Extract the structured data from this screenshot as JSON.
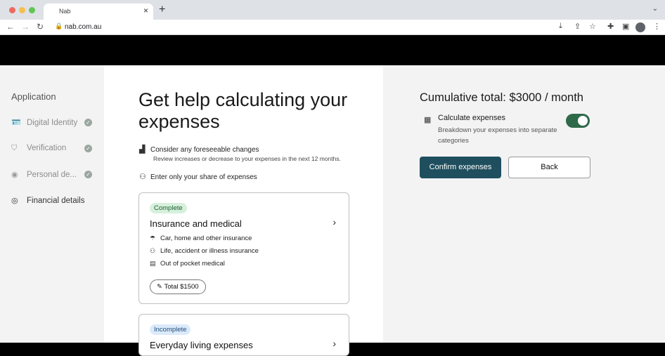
{
  "browser": {
    "tab_title": "Nab",
    "tab_close": "×",
    "new_tab": "+",
    "menu_chevron": "⌄",
    "url": "nab.com.au",
    "traffic_colors": [
      "#ed6a5e",
      "#f5bf4f",
      "#61c554"
    ]
  },
  "sidebar": {
    "title": "Application",
    "items": [
      {
        "label": "Digital Identity",
        "icon": "id-card-icon",
        "done": true
      },
      {
        "label": "Verification",
        "icon": "shield-check-icon",
        "done": true
      },
      {
        "label": "Personal de...",
        "icon": "person-icon",
        "done": true
      },
      {
        "label": "Financial details",
        "icon": "coins-icon",
        "done": false
      }
    ],
    "check_glyph": "✓"
  },
  "main": {
    "heading": "Get help calculating your expenses",
    "tips": [
      {
        "title": "Consider any foreseeable changes",
        "sub": "Review increases or decrease to your expenses in the next 12 months.",
        "icon": "chart-icon"
      },
      {
        "title": "Enter only your share of expenses",
        "icon": "people-icon"
      }
    ],
    "cards": [
      {
        "badge": "Complete",
        "title": "Insurance and medical",
        "lines": [
          {
            "text": "Car, home and other insurance",
            "icon": "umbrella-icon"
          },
          {
            "text": "Life, accident or illness insurance",
            "icon": "people-icon"
          },
          {
            "text": "Out of pocket medical",
            "icon": "medical-icon"
          }
        ],
        "total": "Total $1500"
      },
      {
        "badge": "Incomplete",
        "title": "Everyday living expenses"
      }
    ]
  },
  "summary": {
    "cumulative": "Cumulative total: $3000 / month",
    "calc_title": "Calculate expenses",
    "calc_sub": "Breakdown your expenses into separate categories",
    "toggle_on": true,
    "confirm_label": "Confirm expenses",
    "back_label": "Back",
    "accent": "#1f4f5e",
    "toggle_color": "#2e6a4a"
  }
}
